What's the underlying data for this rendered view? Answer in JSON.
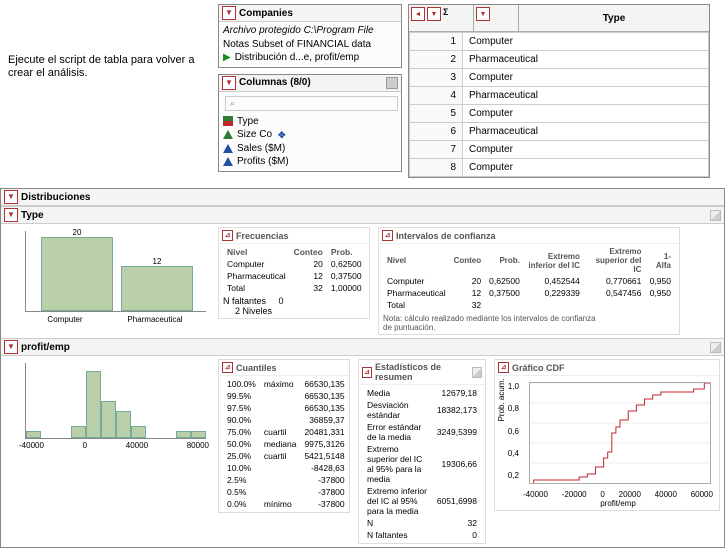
{
  "instruction": "Ejecute el script de tabla para volver a crear el análisis.",
  "companies_panel": {
    "title": "Companies",
    "protected_line": "Archivo protegido  C:\\Program File",
    "notes_line": "Notas  Subset of FINANCIAL data",
    "script_line": "Distribución d...e, profit/emp"
  },
  "columns_panel": {
    "title": "Columnas (8/0)",
    "search_placeholder": "⌕",
    "items": {
      "type": "Type",
      "sizeco": "Size Co",
      "sales": "Sales ($M)",
      "profits": "Profits ($M)"
    }
  },
  "data_table": {
    "header": "Type",
    "rows": [
      [
        "1",
        "Computer"
      ],
      [
        "2",
        "Pharmaceutical"
      ],
      [
        "3",
        "Computer"
      ],
      [
        "4",
        "Pharmaceutical"
      ],
      [
        "5",
        "Computer"
      ],
      [
        "6",
        "Pharmaceutical"
      ],
      [
        "7",
        "Computer"
      ],
      [
        "8",
        "Computer"
      ]
    ]
  },
  "report": {
    "title": "Distribuciones",
    "type_section": {
      "title": "Type",
      "freq_title": "Frecuencias",
      "freq_headers": [
        "Nivel",
        "Conteo",
        "Prob."
      ],
      "freq_rows": [
        [
          "Computer",
          "20",
          "0,62500"
        ],
        [
          "Pharmaceutical",
          "12",
          "0,37500"
        ],
        [
          "Total",
          "32",
          "1,00000"
        ]
      ],
      "freq_missing_label": "N faltantes",
      "freq_missing_val": "0",
      "freq_levels": "2  Niveles",
      "ci_title": "Intervalos de confianza",
      "ci_headers": [
        "Nivel",
        "Conteo",
        "Prob.",
        "Extremo inferior del IC",
        "Extremo superior del IC",
        "1-Alfa"
      ],
      "ci_rows": [
        [
          "Computer",
          "20",
          "0,62500",
          "0,452544",
          "0,770661",
          "0,950"
        ],
        [
          "Pharmaceutical",
          "12",
          "0,37500",
          "0,229339",
          "0,547456",
          "0,950"
        ],
        [
          "Total",
          "32",
          "",
          "",
          "",
          ""
        ]
      ],
      "ci_note": "Nota: cálculo realizado mediante los intervalos de confianza de puntuación.",
      "x_labels": [
        "Computer",
        "Pharmaceutical"
      ],
      "bar_labels": [
        "20",
        "12"
      ]
    },
    "profitemp_section": {
      "title": "profit/emp",
      "quant_title": "Cuantiles",
      "quant_rows": [
        [
          "100.0%",
          "máximo",
          "66530,135"
        ],
        [
          "99.5%",
          "",
          "66530,135"
        ],
        [
          "97.5%",
          "",
          "66530,135"
        ],
        [
          "90.0%",
          "",
          "36859,37"
        ],
        [
          "75.0%",
          "cuartil",
          "20481,331"
        ],
        [
          "50.0%",
          "mediana",
          "9975,3126"
        ],
        [
          "25.0%",
          "cuartil",
          "5421,5148"
        ],
        [
          "10.0%",
          "",
          "-8428,63"
        ],
        [
          "2.5%",
          "",
          "-37800"
        ],
        [
          "0.5%",
          "",
          "-37800"
        ],
        [
          "0.0%",
          "mínimo",
          "-37800"
        ]
      ],
      "summary_title": "Estadísticos de resumen",
      "summary_rows": [
        [
          "Media",
          "12679,18"
        ],
        [
          "Desviación estándar",
          "18382,173"
        ],
        [
          "Error estándar de la media",
          "3249,5399"
        ],
        [
          "Extremo superior del IC al 95% para la media",
          "19306,66"
        ],
        [
          "Extremo inferior del IC al 95% para la media",
          "6051,6998"
        ],
        [
          "N",
          "32"
        ],
        [
          "N faltantes",
          "0"
        ]
      ],
      "cdf_title": "Gráfico CDF",
      "cdf_ylabel": "Prob. acum.",
      "cdf_xlabel": "profit/emp",
      "hist_x_labels": [
        "-40000",
        "0",
        "40000",
        "80000"
      ],
      "cdf_x_labels": [
        "-40000",
        "-20000",
        "0",
        "20000",
        "40000",
        "60000"
      ],
      "cdf_y_labels": [
        "1,0",
        "0,8",
        "0,6",
        "0,4",
        "0,2"
      ]
    }
  },
  "chart_data": [
    {
      "type": "bar",
      "title": "Type frequencies",
      "categories": [
        "Computer",
        "Pharmaceutical"
      ],
      "values": [
        20,
        12
      ],
      "ylim": [
        0,
        22
      ]
    },
    {
      "type": "bar",
      "title": "profit/emp histogram",
      "bin_left_edges": [
        -40000,
        -30000,
        -20000,
        -10000,
        0,
        10000,
        20000,
        30000,
        40000,
        50000,
        60000,
        70000
      ],
      "values": [
        1,
        0,
        0,
        2,
        13,
        7,
        5,
        2,
        0,
        0,
        1,
        1
      ],
      "xlim": [
        -40000,
        80000
      ],
      "ylim": [
        0,
        15
      ]
    },
    {
      "type": "line",
      "title": "CDF profit/emp",
      "xlabel": "profit/emp",
      "ylabel": "Prob. acum.",
      "xlim": [
        -40000,
        70000
      ],
      "ylim": [
        0,
        1
      ],
      "approx_points_x": [
        -37800,
        -30000,
        -10000,
        -5000,
        0,
        5000,
        7500,
        10000,
        12500,
        15000,
        20000,
        25000,
        30000,
        35000,
        40000,
        60000,
        66530
      ],
      "approx_points_y": [
        0.03,
        0.03,
        0.06,
        0.09,
        0.16,
        0.25,
        0.31,
        0.5,
        0.56,
        0.63,
        0.72,
        0.78,
        0.84,
        0.88,
        0.91,
        0.94,
        1.0
      ]
    }
  ]
}
